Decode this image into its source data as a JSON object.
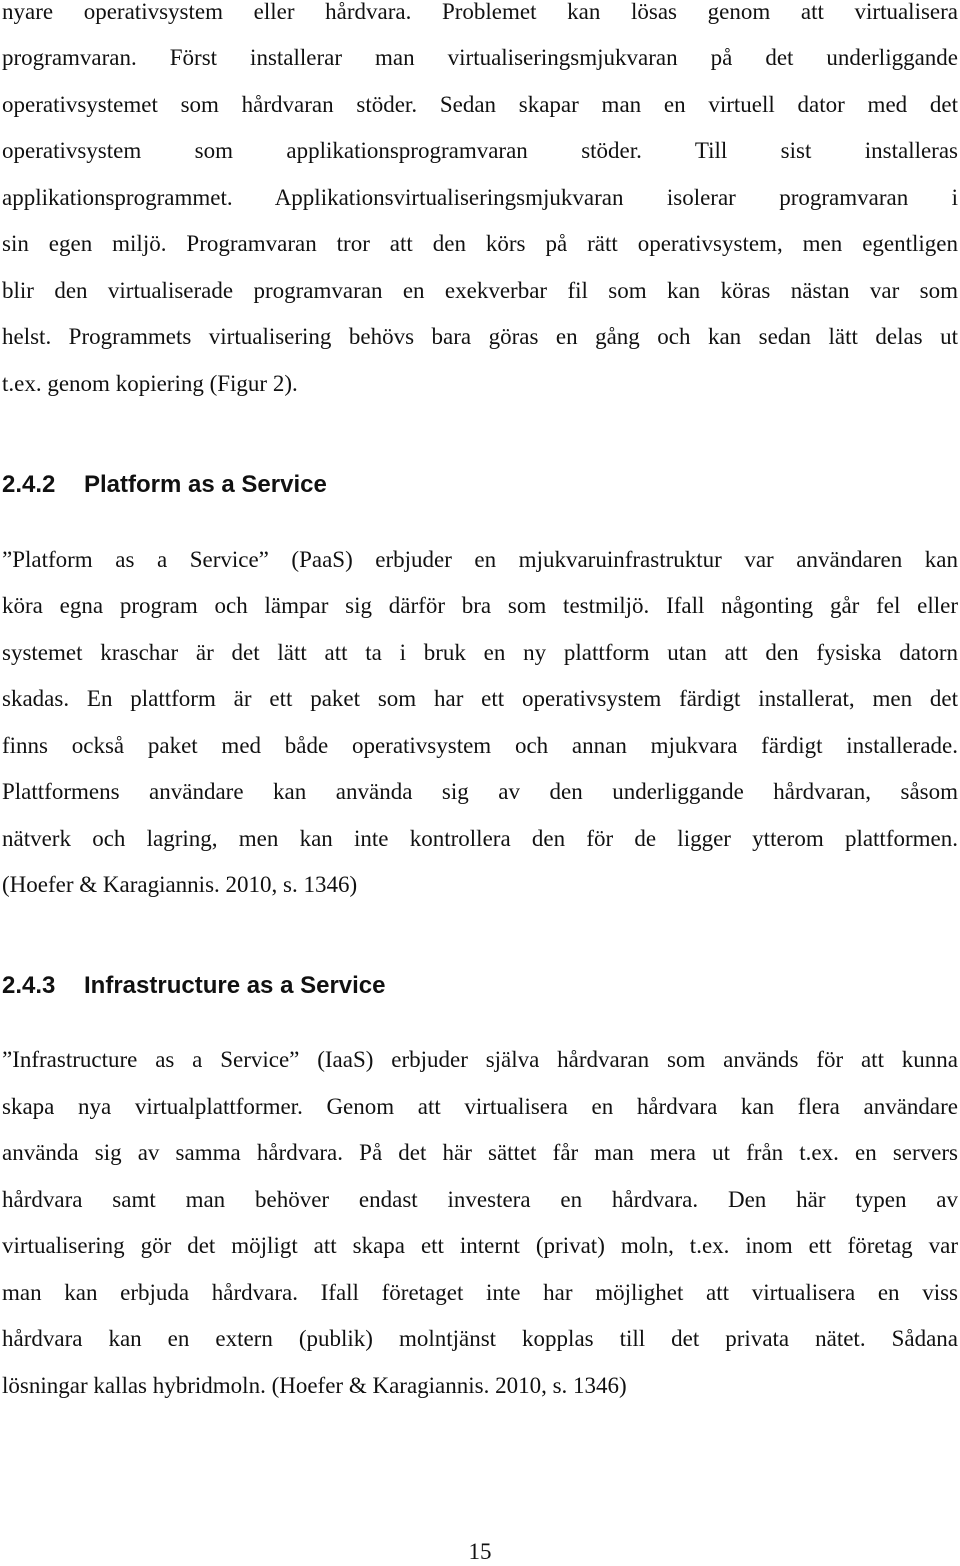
{
  "paragraph_intro": {
    "lines": [
      "nyare operativsystem eller hårdvara. Problemet kan lösas genom att virtualisera",
      "programvaran. Först installerar man virtualiseringsmjukvaran på det underliggande",
      "operativsystemet som hårdvaran stöder. Sedan skapar man en virtuell dator med det",
      "operativsystem som applikationsprogramvaran stöder. Till sist installeras",
      "applikationsprogrammet. Applikationsvirtualiseringsmjukvaran isolerar programvaran i",
      "sin egen miljö. Programvaran tror att den körs på rätt operativsystem, men egentligen",
      "blir den virtualiserade programvaran en exekverbar fil som kan köras nästan var som",
      "helst. Programmets virtualisering behövs bara göras en gång och kan sedan lätt delas ut",
      "t.ex. genom kopiering (Figur 2)."
    ]
  },
  "section_paas": {
    "number": "2.4.2",
    "title": "Platform as a Service",
    "lines": [
      "”Platform as a Service” (PaaS) erbjuder en mjukvaruinfrastruktur var användaren kan",
      "köra egna program och lämpar sig därför bra som testmiljö. Ifall någonting går fel eller",
      "systemet kraschar är det lätt att ta i bruk en ny plattform utan att den fysiska datorn",
      "skadas. En plattform är ett paket som har ett operativsystem färdigt installerat, men det",
      "finns också paket med både operativsystem och annan mjukvara färdigt installerade.",
      "Plattformens användare kan använda sig av den underliggande hårdvaran, såsom",
      "nätverk och lagring, men kan inte kontrollera den för de ligger ytterom plattformen.",
      "(Hoefer & Karagiannis. 2010, s. 1346)"
    ]
  },
  "section_iaas": {
    "number": "2.4.3",
    "title": "Infrastructure as a Service",
    "lines": [
      "”Infrastructure as a Service” (IaaS) erbjuder själva hårdvaran som används för att kunna",
      "skapa nya virtualplattformer. Genom att virtualisera en hårdvara kan flera användare",
      "använda sig av samma hårdvara. På det här sättet får man mera ut från t.ex. en servers",
      "hårdvara samt man behöver endast investera en hårdvara. Den här typen av",
      "virtualisering gör det möjligt att skapa ett internt (privat) moln, t.ex. inom ett företag var",
      "man kan erbjuda hårdvara. Ifall företaget inte har möjlighet att virtualisera en viss",
      "hårdvara kan en extern (publik) molntjänst kopplas till det privata nätet. Sådana",
      "lösningar kallas hybridmoln. (Hoefer & Karagiannis. 2010, s. 1346)"
    ]
  },
  "footer": {
    "page_number": "15"
  }
}
